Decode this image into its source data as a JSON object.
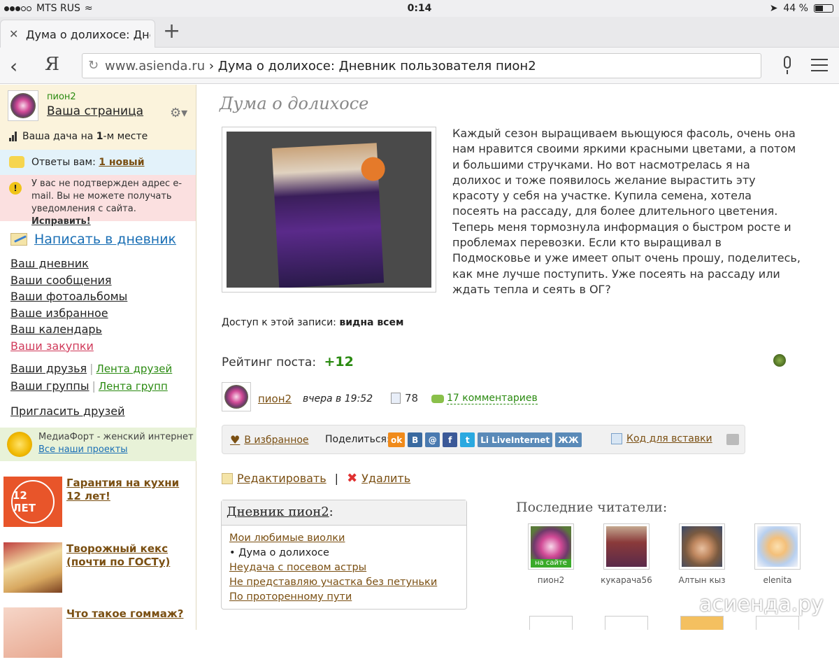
{
  "status": {
    "carrier": "MTS RUS",
    "time": "0:14",
    "battery": "44 %"
  },
  "tab": {
    "title": "Дума о долихосе: Днев",
    "close": "✕",
    "new": "+"
  },
  "address": {
    "back": "‹",
    "ya": "Я",
    "domain": "www.asienda.ru",
    "sep": " › ",
    "path": "Дума о долихосе: Дневник пользователя пион2"
  },
  "sidebar": {
    "username": "пион2",
    "my_page": "Ваша страница",
    "rank_pre": "Ваша дача на ",
    "rank_num": "1",
    "rank_post": "-м месте",
    "answers_label": "Ответы вам: ",
    "answers_link": "1 новый",
    "warning_text": "У вас не подтвержден адрес e-mail. Вы не можете получать уведомления с сайта. ",
    "warning_fix": "Исправить!",
    "write": "Написать в дневник",
    "menu": [
      "Ваш дневник",
      "Ваши сообщения",
      "Ваши фотоальбомы",
      "Ваше избранное",
      "Ваш календарь",
      "Ваши закупки"
    ],
    "friends": "Ваши друзья",
    "friends_feed": "Лента друзей",
    "groups": "Ваши группы",
    "groups_feed": "Лента групп",
    "invite": "Пригласить друзей",
    "mediafort": "МедиаФорт - женский интернет",
    "all_projects": "Все наши проекты",
    "promos": [
      {
        "img_text": "12 ЛЕТ",
        "caption": "Гарантия на кухни 12 лет!"
      },
      {
        "caption": "Творожный кекс (почти по ГОСТу)"
      },
      {
        "caption": "Что такое гоммаж?"
      }
    ]
  },
  "post": {
    "title": "Дума о долихосе",
    "body": "Каждый сезон выращиваем вьющуюся фасоль, очень она нам нравится своими яркими красными цветами, а потом и большими стручками. Но вот насмотрелась я на долихос и тоже появилось желание вырастить эту красоту у себя на участке. Купила семена, хотела посеять на рассаду, для более длительного цветения. Теперь меня тормознула информация о быстром росте и проблемах перевозки. Если кто выращивал в Подмосковье и уже имеет опыт очень прошу, поделитесь, как мне лучше поступить. Уже посеять на рассаду или ждать тепла и сеять в ОГ?",
    "access_label": "Доступ к этой записи: ",
    "access_value": "видна всем",
    "rating_label": "Рейтинг поста: ",
    "rating_value": "+12",
    "author": "пион2",
    "date": "вчера в 19:52",
    "views": "78",
    "comments": "17 комментариев",
    "favorite": "В избранное",
    "share_label": "Поделиться:",
    "share_icons": [
      {
        "label": "ok",
        "color": "#f08a1a"
      },
      {
        "label": "B",
        "color": "#3a6aa0"
      },
      {
        "label": "@",
        "color": "#4a7ab0"
      },
      {
        "label": "f",
        "color": "#3b5998"
      },
      {
        "label": "t",
        "color": "#2aa9e0"
      },
      {
        "label": "Li LiveInternet",
        "color": "#5a8ab8"
      },
      {
        "label": "ЖЖ",
        "color": "#5a8ab8"
      }
    ],
    "embed_code": "Код для вставки",
    "edit": "Редактировать",
    "sep": "|",
    "delete": "Удалить"
  },
  "diary": {
    "header_name": "Дневник пион2",
    "header_colon": ":",
    "items": [
      {
        "text": "Мои любимые виолки",
        "current": false
      },
      {
        "text": "• Дума о долихосе",
        "current": true
      },
      {
        "text": "Неудача с посевом астры",
        "current": false
      },
      {
        "text": "Не представляю участка без петуньки",
        "current": false
      },
      {
        "text": "По проторенному пути",
        "current": false
      }
    ]
  },
  "readers": {
    "title": "Последние читатели:",
    "online_label": "на сайте",
    "list": [
      {
        "name": "пион2",
        "online": true
      },
      {
        "name": "кукарача56",
        "online": false
      },
      {
        "name": "Алтын кыз",
        "online": false
      },
      {
        "name": "elenita",
        "online": false
      }
    ]
  },
  "watermark": "асиенда.ру"
}
